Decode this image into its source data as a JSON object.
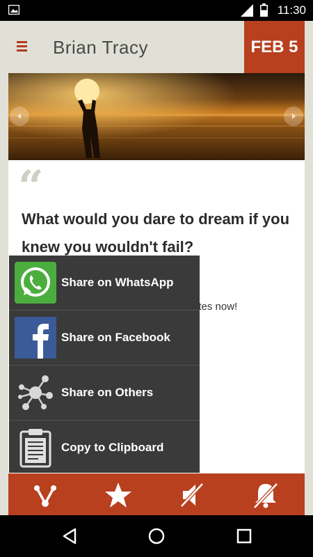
{
  "status_bar": {
    "time": "11:30"
  },
  "header": {
    "title": "Brian Tracy",
    "date": "FEB 5"
  },
  "quote": {
    "mark": "“",
    "text": "What would you dare to dream if you knew you wouldn't fail?",
    "trailing_text": "ites now!"
  },
  "share_menu": {
    "items": [
      {
        "label": "Share on WhatsApp",
        "icon": "whatsapp-icon"
      },
      {
        "label": "Share on Facebook",
        "icon": "facebook-icon"
      },
      {
        "label": "Share on Others",
        "icon": "share-network-icon"
      },
      {
        "label": "Copy to Clipboard",
        "icon": "clipboard-icon"
      }
    ]
  },
  "colors": {
    "accent": "#b8401f",
    "background": "#e0e0d6",
    "menu": "#3a3a3a"
  },
  "bottom_bar": {
    "icons": [
      "share-icon",
      "star-icon",
      "sound-off-icon",
      "notifications-off-icon"
    ]
  },
  "nav_bar": {
    "icons": [
      "back-icon",
      "home-icon",
      "recents-icon"
    ]
  }
}
